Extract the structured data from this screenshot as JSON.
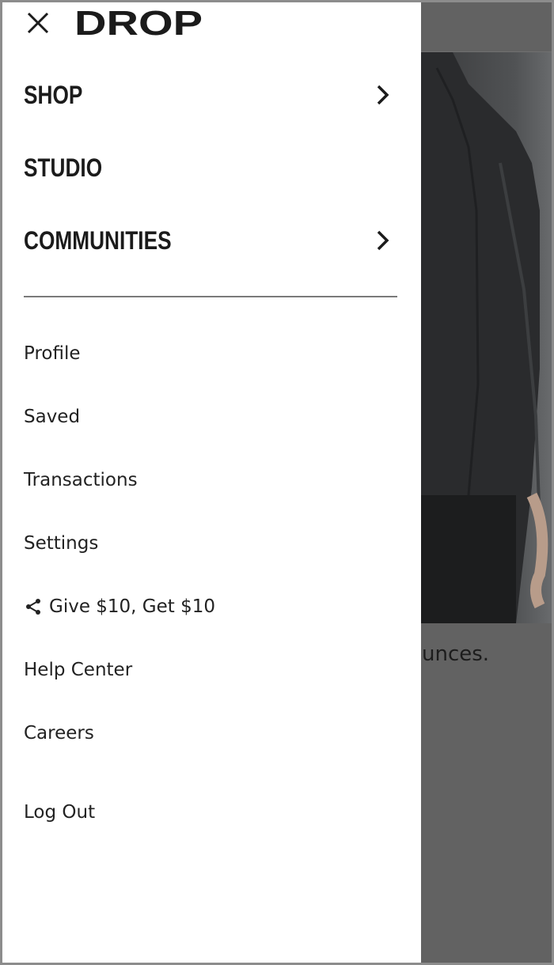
{
  "brand": {
    "logo_text": "DROP"
  },
  "drawer": {
    "primary_nav": [
      {
        "label": "SHOP",
        "has_submenu": true
      },
      {
        "label": "STUDIO",
        "has_submenu": false
      },
      {
        "label": "COMMUNITIES",
        "has_submenu": true
      }
    ],
    "secondary_nav": [
      {
        "label": "Profile"
      },
      {
        "label": "Saved"
      },
      {
        "label": "Transactions"
      },
      {
        "label": "Settings"
      },
      {
        "label": "Give $10, Get $10",
        "icon": "share-icon"
      },
      {
        "label": "Help Center"
      },
      {
        "label": "Careers"
      },
      {
        "label": "Log Out"
      }
    ],
    "close_icon": "close-icon",
    "chevron_icon": "chevron-right-icon"
  },
  "background_page": {
    "partial_text": "unces."
  },
  "colors": {
    "drawer_bg": "#ffffff",
    "overlay": "#626262",
    "text_primary": "#1b1b1b",
    "divider": "#7a7a7a"
  }
}
